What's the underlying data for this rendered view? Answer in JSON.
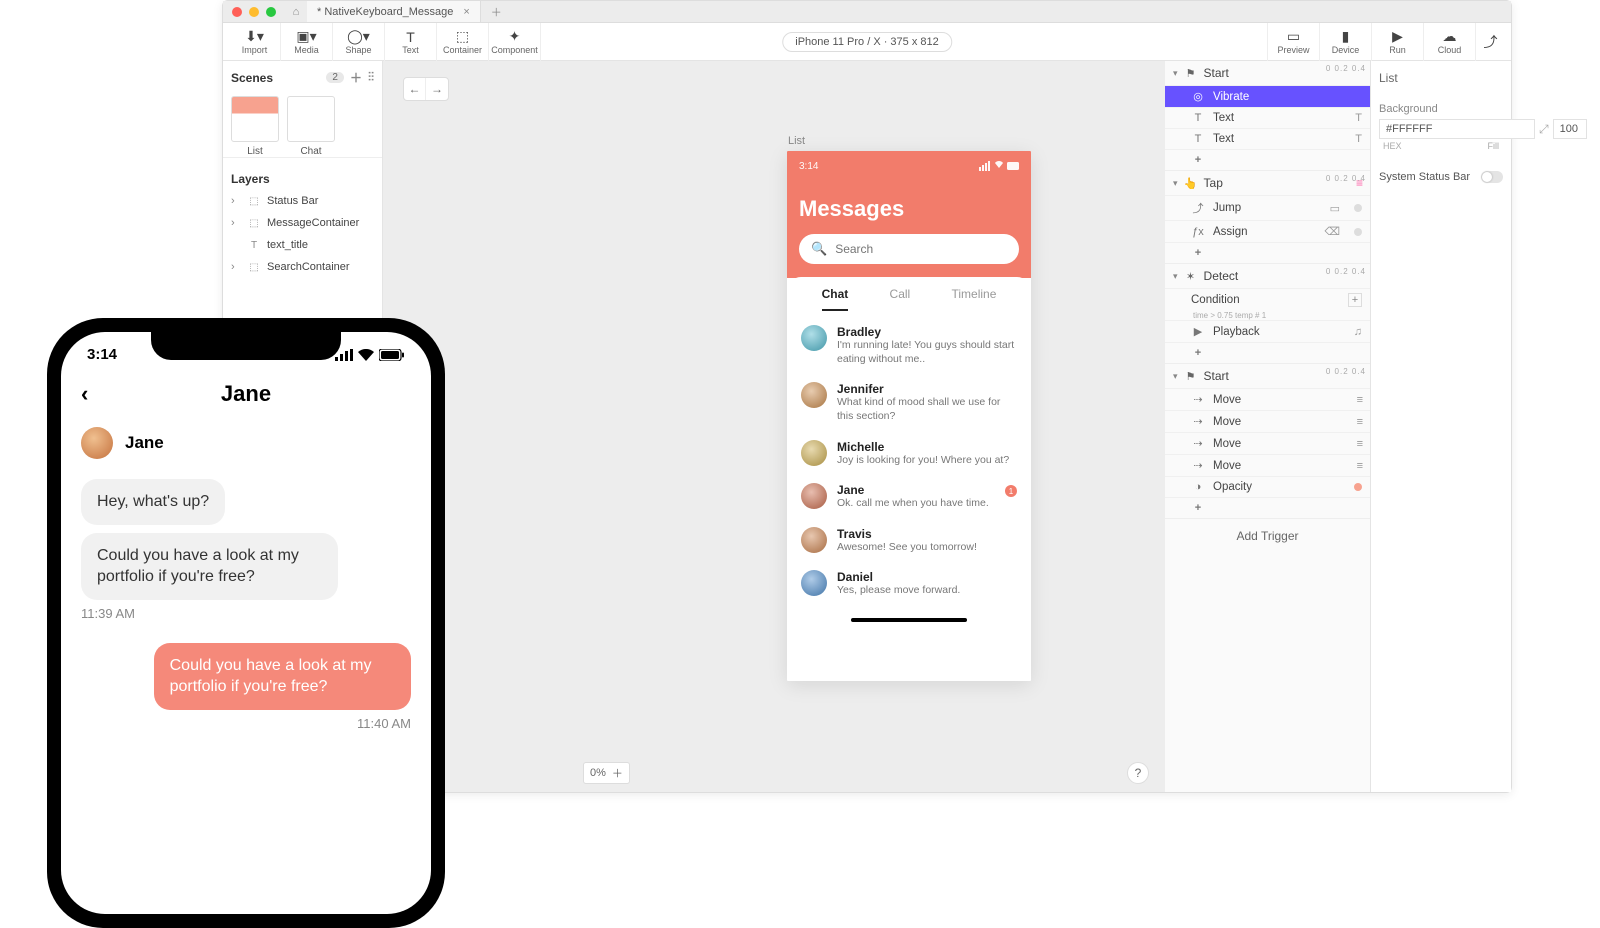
{
  "titlebar": {
    "tab": "* NativeKeyboard_Message"
  },
  "toolbar": {
    "import": "Import",
    "media": "Media",
    "shape": "Shape",
    "text": "Text",
    "container": "Container",
    "component": "Component",
    "device": "iPhone 11 Pro / X  ·  375 x 812",
    "preview": "Preview",
    "device_btn": "Device",
    "run": "Run",
    "cloud": "Cloud"
  },
  "leftpanel": {
    "scenes_label": "Scenes",
    "scenes_count": "2",
    "scene1": "List",
    "scene2": "Chat",
    "layers_label": "Layers",
    "layers": [
      "Status Bar",
      "MessageContainer",
      "text_title",
      "SearchContainer"
    ]
  },
  "canvas": {
    "artboard_label": "List",
    "time": "3:14",
    "title": "Messages",
    "search_ph": "Search",
    "tab_chat": "Chat",
    "tab_call": "Call",
    "tab_timeline": "Timeline",
    "chats": [
      {
        "name": "Bradley",
        "msg": "I'm running late! You guys should start eating without me.."
      },
      {
        "name": "Jennifer",
        "msg": "What kind of mood shall we use for this section?"
      },
      {
        "name": "Michelle",
        "msg": "Joy is looking for you! Where you at?"
      },
      {
        "name": "Jane",
        "msg": "Ok. call me when you have time.",
        "badge": "1"
      },
      {
        "name": "Travis",
        "msg": "Awesome! See you tomorrow!"
      },
      {
        "name": "Daniel",
        "msg": "Yes, please move forward."
      }
    ],
    "avatar_hues": [
      190,
      30,
      45,
      15,
      25,
      210
    ],
    "zoom": "0%"
  },
  "triggers": {
    "groups": {
      "start1": {
        "label": "Start",
        "ruler": "0     0.2     0.4",
        "rows": [
          {
            "icon": "◎",
            "label": "Vibrate",
            "selected": true
          },
          {
            "icon": "T",
            "label": "Text",
            "tail": "T"
          },
          {
            "icon": "T",
            "label": "Text",
            "tail": "T"
          }
        ]
      },
      "tap": {
        "label": "Tap",
        "ruler": "0     0.2     0.4",
        "rows": [
          {
            "icon": "⤴",
            "label": "Jump",
            "tail": "▭"
          },
          {
            "icon": "ƒx",
            "label": "Assign",
            "tail": "⌫"
          }
        ]
      },
      "detect": {
        "label": "Detect",
        "ruler": "0     0.2     0.4",
        "cond_label": "Condition",
        "cond_note": "time > 0.75        temp # 1",
        "rows": [
          {
            "icon": "▶",
            "label": "Playback",
            "tail": "♫"
          }
        ]
      },
      "start2": {
        "label": "Start",
        "ruler": "0     0.2     0.4",
        "rows": [
          {
            "icon": "⇢",
            "label": "Move",
            "tailcls": "pink-bars",
            "tail": "≡"
          },
          {
            "icon": "⇢",
            "label": "Move",
            "tailcls": "pink-bars",
            "tail": "≡"
          },
          {
            "icon": "⇢",
            "label": "Move",
            "tailcls": "pink-bars",
            "tail": "≡"
          },
          {
            "icon": "⇢",
            "label": "Move",
            "tailcls": "pink-bars",
            "tail": "≡"
          },
          {
            "icon": "◑",
            "label": "Opacity",
            "dot": true
          }
        ]
      }
    },
    "add_trigger": "Add Trigger"
  },
  "props": {
    "title": "List",
    "bg_label": "Background",
    "bg_hex": "#FFFFFF",
    "bg_fill": "100",
    "hex_caption": "HEX",
    "fill_caption": "Fill",
    "sysbar": "System Status Bar"
  },
  "phone": {
    "time": "3:14",
    "title": "Jane",
    "contact": "Jane",
    "m1": "Hey, what's up?",
    "m2": "Could you have a look at my portfolio if you're free?",
    "t1": "11:39 AM",
    "m3": "Could you have a look at my portfolio if you're free?",
    "t2": "11:40 AM"
  }
}
